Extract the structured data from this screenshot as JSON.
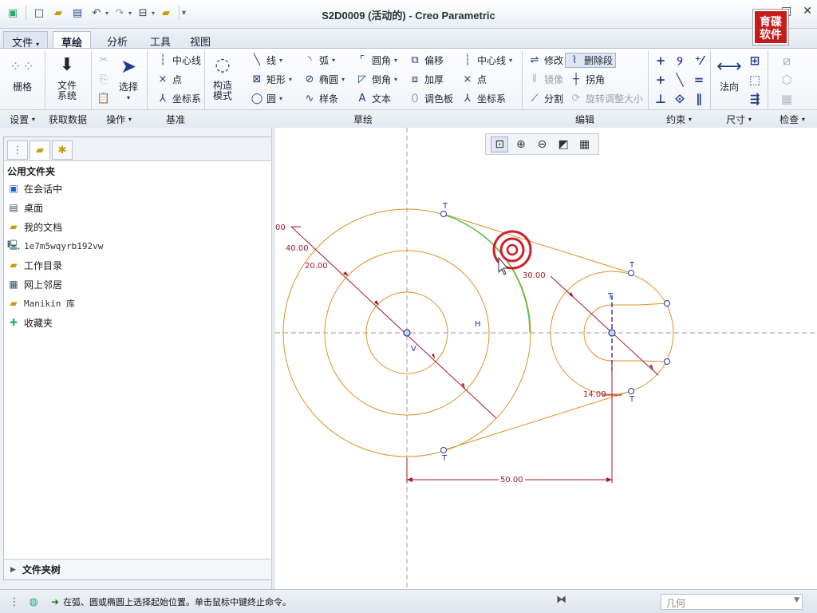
{
  "window": {
    "title": "S2D0009 (活动的) - Creo Parametric",
    "brand_line1": "育碟",
    "brand_line2": "软件"
  },
  "quick_access": [
    {
      "name": "app-icon",
      "glyph": "▣"
    },
    {
      "name": "new-file-icon",
      "glyph": "🗋"
    },
    {
      "name": "open-folder-icon",
      "glyph": "📂"
    },
    {
      "name": "save-icon",
      "glyph": "💾"
    },
    {
      "name": "undo-icon",
      "glyph": "↶"
    },
    {
      "name": "redo-icon",
      "glyph": "↷"
    },
    {
      "name": "regenerate-icon",
      "glyph": "⊟"
    },
    {
      "name": "folder-icon",
      "glyph": "📁"
    }
  ],
  "menu": {
    "file": "文件",
    "tabs": [
      "草绘",
      "分析",
      "工具",
      "视图"
    ]
  },
  "ribbon": {
    "grid": "栅格",
    "file_system_line1": "文件",
    "file_system_line2": "系统",
    "select": "选择",
    "construction_line1": "构造",
    "construction_line2": "模式",
    "centerline": "中心线",
    "point": "点",
    "coord_sys": "坐标系",
    "line": "线",
    "rectangle": "矩形",
    "circle": "圆",
    "arc": "弧",
    "ellipse": "椭圆",
    "spline": "样条",
    "fillet": "圆角",
    "chamfer": "倒角",
    "text": "文本",
    "offset": "偏移",
    "thicken": "加厚",
    "palette": "调色板",
    "centerline2": "中心线",
    "point2": "点",
    "coord_sys2": "坐标系",
    "modify": "修改",
    "delete_segment": "删除段",
    "mirror": "镜像",
    "corner": "拐角",
    "divide": "分割",
    "rotate_resize": "旋转调整大小",
    "normal": "法向",
    "groups": {
      "setup": "设置",
      "get_data": "获取数据",
      "operations": "操作",
      "datum": "基准",
      "sketching": "草绘",
      "editing": "编辑",
      "constrain": "约束",
      "dimension": "尺寸",
      "inspect": "检查"
    }
  },
  "left_panel": {
    "header": "公用文件夹",
    "items": [
      {
        "label": "在会话中",
        "icon": "session-icon"
      },
      {
        "label": "桌面",
        "icon": "desktop-icon"
      },
      {
        "label": "我的文档",
        "icon": "my-documents-icon"
      },
      {
        "label": "1e7m5wqyrb192vw",
        "icon": "computer-icon"
      },
      {
        "label": "工作目录",
        "icon": "working-directory-icon"
      },
      {
        "label": "网上邻居",
        "icon": "network-icon"
      },
      {
        "label": "Manikin 库",
        "icon": "manikin-library-icon"
      },
      {
        "label": "收藏夹",
        "icon": "favorites-icon"
      }
    ],
    "footer": "文件夹树"
  },
  "sketch": {
    "dim_left_cut": "00",
    "dim_40": "40.00",
    "dim_20": "20.00",
    "dim_30": "30.00",
    "dim_14": "14.00",
    "dim_50": "50.00",
    "label_h": "H",
    "label_v": "V",
    "label_t": "T"
  },
  "status": {
    "message": "在弧、圆或椭圆上选择起始位置。单击鼠标中键终止命令。",
    "filter": "几何"
  }
}
